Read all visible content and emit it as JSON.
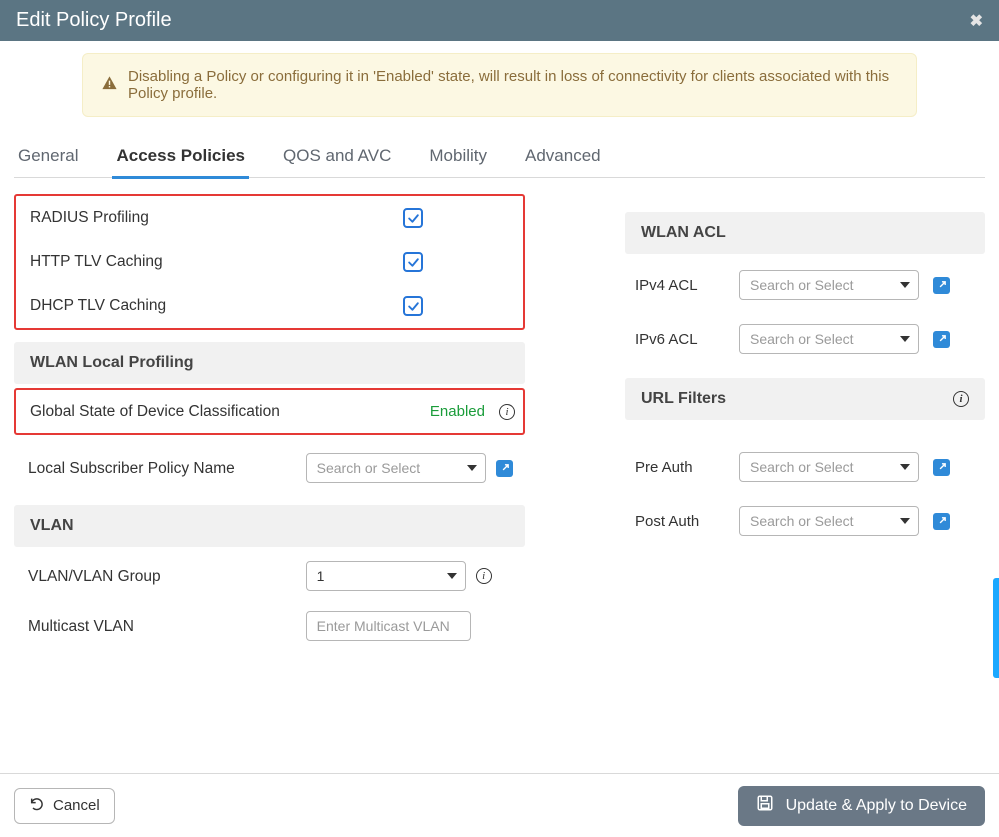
{
  "window": {
    "title": "Edit Policy Profile"
  },
  "alert": {
    "text": "Disabling a Policy or configuring it in 'Enabled' state, will result in loss of connectivity for clients associated with this Policy profile."
  },
  "tabs": [
    {
      "label": "General"
    },
    {
      "label": "Access Policies",
      "active": true
    },
    {
      "label": "QOS and AVC"
    },
    {
      "label": "Mobility"
    },
    {
      "label": "Advanced"
    }
  ],
  "left": {
    "profiling": {
      "radius_label": "RADIUS Profiling",
      "radius_checked": true,
      "http_label": "HTTP TLV Caching",
      "http_checked": true,
      "dhcp_label": "DHCP TLV Caching",
      "dhcp_checked": true
    },
    "wlan_local_profiling_header": "WLAN Local Profiling",
    "device_class": {
      "label": "Global State of Device Classification",
      "state": "Enabled"
    },
    "subscriber": {
      "label": "Local Subscriber Policy Name",
      "placeholder": "Search or Select",
      "value": ""
    },
    "vlan_header": "VLAN",
    "vlan_group": {
      "label": "VLAN/VLAN Group",
      "value": "1"
    },
    "multicast": {
      "label": "Multicast VLAN",
      "placeholder": "Enter Multicast VLAN",
      "value": ""
    }
  },
  "right": {
    "wlan_acl_header": "WLAN ACL",
    "ipv4": {
      "label": "IPv4 ACL",
      "placeholder": "Search or Select",
      "value": ""
    },
    "ipv6": {
      "label": "IPv6 ACL",
      "placeholder": "Search or Select",
      "value": ""
    },
    "url_filters_header": "URL Filters",
    "pre": {
      "label": "Pre Auth",
      "placeholder": "Search or Select",
      "value": ""
    },
    "post": {
      "label": "Post Auth",
      "placeholder": "Search or Select",
      "value": ""
    }
  },
  "footer": {
    "cancel": "Cancel",
    "apply": "Update & Apply to Device"
  }
}
